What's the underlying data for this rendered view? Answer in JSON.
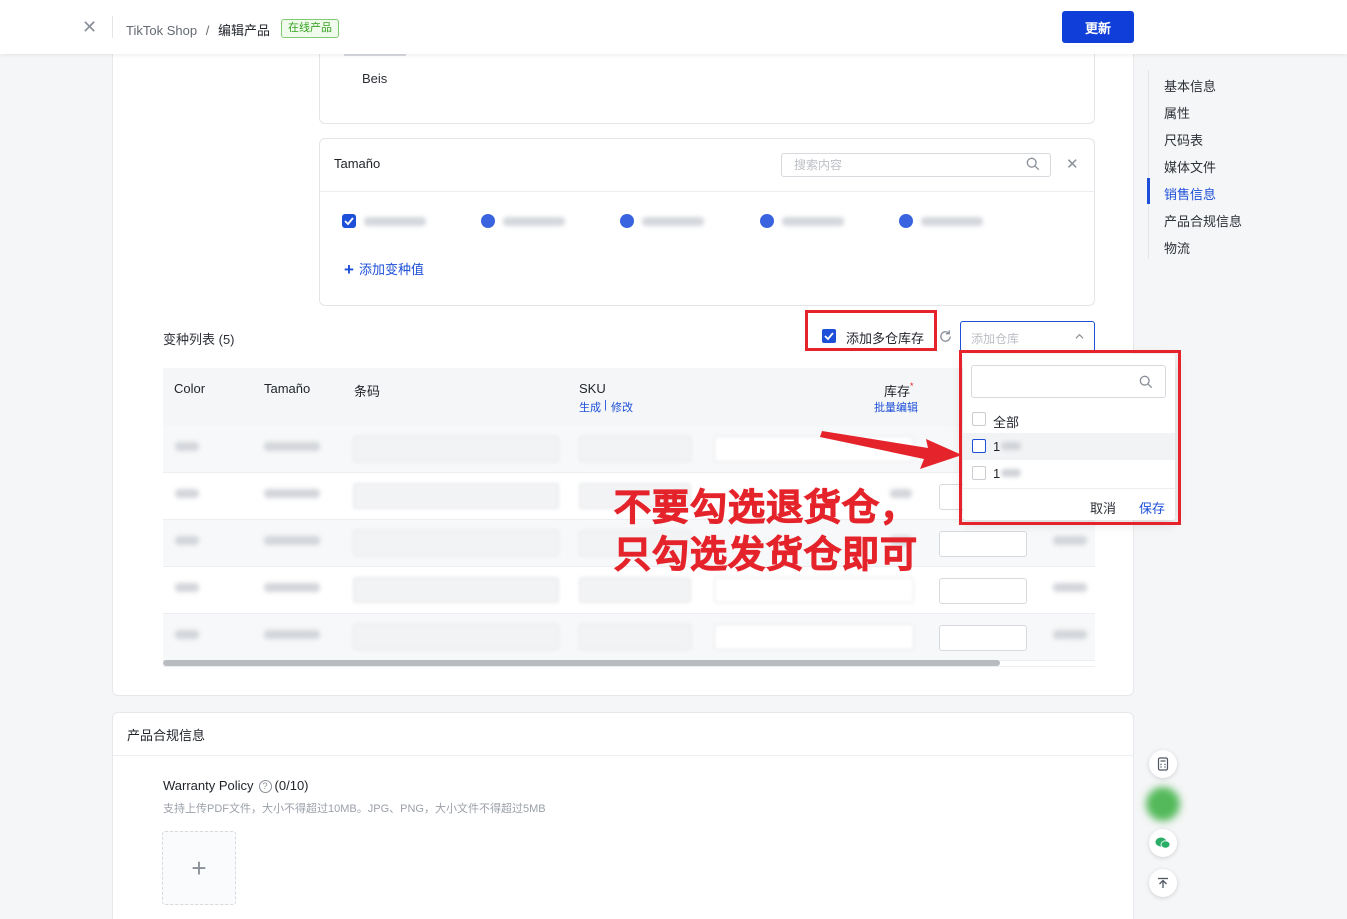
{
  "topbar": {
    "breadcrumb_shop": "TikTok Shop",
    "breadcrumb_sep": "/",
    "breadcrumb_page": "编辑产品",
    "status_badge": "在线产品",
    "update_button": "更新"
  },
  "color_section": {
    "value": "Beis"
  },
  "size_section": {
    "title": "Tamaño",
    "search_placeholder": "搜索内容",
    "add_variant": "添加变种值"
  },
  "variants": {
    "title": "变种列表 (5)",
    "multi_warehouse_label": "添加多仓库存",
    "multi_warehouse_checked": true,
    "warehouse_placeholder": "添加仓库",
    "columns": {
      "color": "Color",
      "size": "Tamaño",
      "barcode": "条码",
      "sku": "SKU",
      "sku_generate": "生成",
      "sku_divider": "|",
      "sku_edit": "修改",
      "stock": "库存",
      "stock_required": "*",
      "stock_bulk_edit": "批量编辑"
    }
  },
  "warehouse_dropdown": {
    "all_label": "全部",
    "item1_label": "1",
    "item2_label": "1",
    "cancel": "取消",
    "save": "保存"
  },
  "annotation": {
    "line1": "不要勾选退货仓，",
    "line2": "只勾选发货仓即可",
    "color": "#e4232a"
  },
  "right_nav": {
    "items": [
      "基本信息",
      "属性",
      "尺码表",
      "媒体文件",
      "销售信息",
      "产品合规信息",
      "物流"
    ],
    "active": "销售信息"
  },
  "compliance": {
    "title": "产品合规信息",
    "warranty_label": "Warranty Policy",
    "warranty_count": "(0/10)",
    "warranty_hint": "支持上传PDF文件，大小不得超过10MB。JPG、PNG，大小文件不得超过5MB",
    "upload_symbol": "+"
  },
  "colors": {
    "primary": "#0f3fd8",
    "link": "#1d4fd8",
    "annotation_red": "#e4232a",
    "badge_green": "#35a41f"
  }
}
